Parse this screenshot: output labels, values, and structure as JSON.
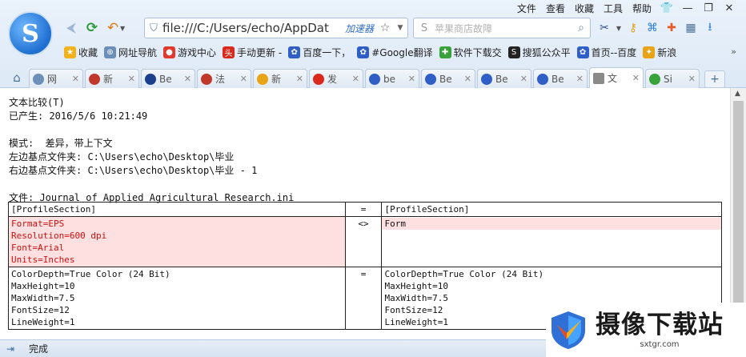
{
  "menubar": {
    "items": [
      "文件",
      "查看",
      "收藏",
      "工具",
      "帮助"
    ],
    "win_controls": [
      "👕",
      "—",
      "❐",
      "✕"
    ]
  },
  "browser": {
    "logo_letter": "S",
    "url": "file:///C:/Users/echo/AppDat",
    "accelerator": "加速器",
    "search_placeholder": "苹果商店故障"
  },
  "bookmarks": [
    {
      "label": "收藏",
      "color": "#f1b21b",
      "glyph": "★"
    },
    {
      "label": "网址导航",
      "color": "#6b8fb8",
      "glyph": "⊕"
    },
    {
      "label": "游戏中心",
      "color": "#e03a2f",
      "glyph": "●"
    },
    {
      "label": "手动更新 -",
      "color": "#d9281c",
      "glyph": "头"
    },
    {
      "label": "百度一下，",
      "color": "#2f5ec7",
      "glyph": "✿"
    },
    {
      "label": "#Google翻译",
      "color": "#2f5ec7",
      "glyph": "✿"
    },
    {
      "label": "软件下载交",
      "color": "#3aa23a",
      "glyph": "✚"
    },
    {
      "label": "搜狐公众平",
      "color": "#222222",
      "glyph": "S"
    },
    {
      "label": "首页--百度",
      "color": "#2f5ec7",
      "glyph": "✿"
    },
    {
      "label": "新浪",
      "color": "#e8a317",
      "glyph": "✦"
    }
  ],
  "bookmarks_more": "»",
  "tabs": [
    {
      "label": "网",
      "color": "#6b8fb8",
      "active": false
    },
    {
      "label": "新",
      "color": "#c0392b",
      "active": false
    },
    {
      "label": "Be",
      "color": "#1c3f8c",
      "active": false
    },
    {
      "label": "法",
      "color": "#c0392b",
      "active": false
    },
    {
      "label": "新",
      "color": "#e8a317",
      "active": false
    },
    {
      "label": "发",
      "color": "#d9281c",
      "active": false
    },
    {
      "label": "be",
      "color": "#2f5ec7",
      "active": false
    },
    {
      "label": "Be",
      "color": "#2f5ec7",
      "active": false
    },
    {
      "label": "Be",
      "color": "#2f5ec7",
      "active": false
    },
    {
      "label": "Be",
      "color": "#2f5ec7",
      "active": false
    },
    {
      "label": "文",
      "color": "#8a8a8a",
      "active": true
    },
    {
      "label": "Si",
      "color": "#3aa23a",
      "active": false
    }
  ],
  "report": {
    "title": "文本比较(T)",
    "generated": "已产生: 2016/5/6 10:21:49",
    "mode": "模式:  差异，带上下文",
    "left_folder": "左边基点文件夹: C:\\Users\\echo\\Desktop\\毕业",
    "right_folder": "右边基点文件夹: C:\\Users\\echo\\Desktop\\毕业 - 1",
    "file": "文件: Journal of Applied Agricultural Research.ini"
  },
  "comparison": {
    "rows": [
      {
        "left": [
          "[ProfileSection]"
        ],
        "op": "=",
        "right": [
          "[ProfileSection]"
        ],
        "diff": false
      },
      {
        "left": [
          "Format=EPS",
          "Resolution=600 dpi",
          "Font=Arial",
          "Units=Inches"
        ],
        "op": "<>",
        "right": [
          "Form"
        ],
        "diff": true
      },
      {
        "left": [
          "ColorDepth=True Color (24 Bit)",
          "MaxHeight=10",
          "MaxWidth=7.5",
          "FontSize=12",
          "LineWeight=1"
        ],
        "op": "=",
        "right": [
          "ColorDepth=True Color (24 Bit)",
          "MaxHeight=10",
          "MaxWidth=7.5",
          "FontSize=12",
          "LineWeight=1"
        ],
        "diff": false
      }
    ]
  },
  "status": {
    "text": "完成"
  },
  "watermark": {
    "title": "摄像下载站",
    "url": "sxtgr.com"
  },
  "colors": {
    "diff_bg": "#ffe0e0",
    "diff_text": "#cc1010",
    "chrome_bg": "#eaf2fb"
  }
}
